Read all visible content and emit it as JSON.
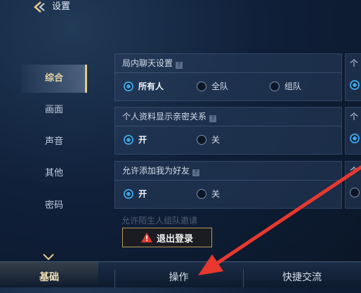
{
  "header": {
    "title": "设置",
    "back_icon": "back-chevron-icon"
  },
  "sidebar": {
    "items": [
      {
        "label": "综合",
        "active": true
      },
      {
        "label": "画面",
        "active": false
      },
      {
        "label": "声音",
        "active": false
      },
      {
        "label": "其他",
        "active": false
      },
      {
        "label": "密码",
        "active": false
      }
    ]
  },
  "settings": [
    {
      "title": "局内聊天设置",
      "options": [
        "所有人",
        "全队",
        "组队"
      ],
      "selected": 0
    },
    {
      "title": "个人资料显示亲密关系",
      "options": [
        "开",
        "关"
      ],
      "selected": 0
    },
    {
      "title": "允许添加我为好友",
      "options": [
        "开",
        "关"
      ],
      "selected": 0
    }
  ],
  "partial_setting_title": "允许陌生人组队邀请",
  "right_column_fragment": "个",
  "logout_label": "退出登录",
  "bottom_tabs": [
    {
      "label": "基础",
      "active": true
    },
    {
      "label": "操作",
      "active": false
    },
    {
      "label": "快捷交流",
      "active": false
    }
  ],
  "colors": {
    "accent_gold": "#e8c987",
    "radio_blue": "#3aa3e6",
    "annotation_red": "#e8382f"
  }
}
